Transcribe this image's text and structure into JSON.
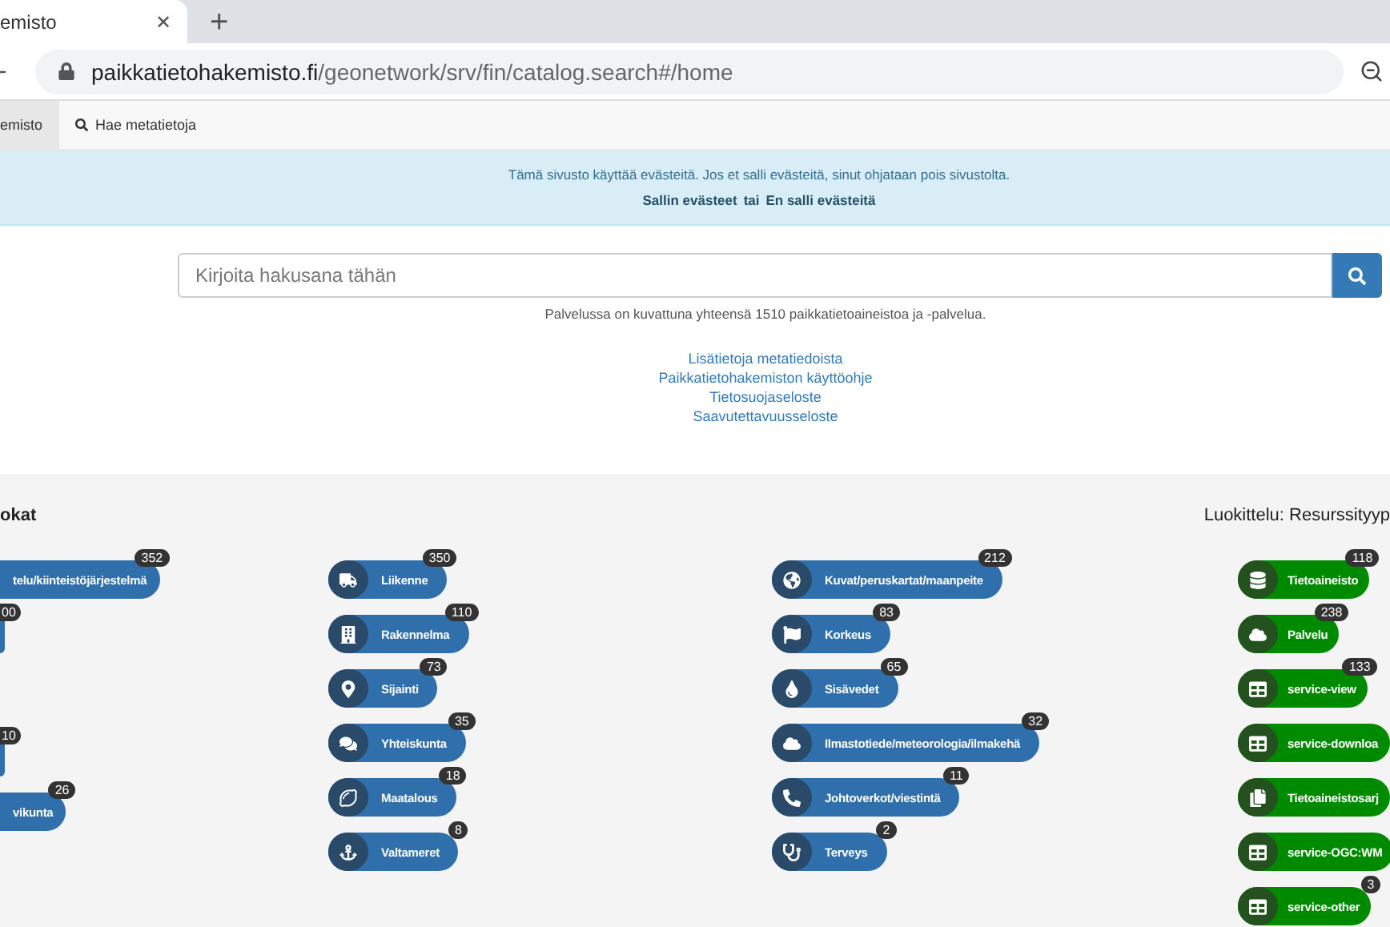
{
  "browser": {
    "tab_title": "emisto",
    "tab_close": "✕",
    "new_tab": "+",
    "url_domain": "paikkatietohakemisto.fi",
    "url_path": "/geonetwork/srv/fin/catalog.search#/home"
  },
  "nav": {
    "items": [
      {
        "label": "emisto",
        "selected": true
      },
      {
        "label": "Hae metatietoja",
        "selected": false
      }
    ]
  },
  "cookie_banner": {
    "text": "Tämä sivusto käyttää evästeitä. Jos et salli evästeitä, sinut ohjataan pois sivustolta.",
    "accept": "Sallin evästeet",
    "separator": "tai",
    "decline": "En salli evästeitä"
  },
  "search": {
    "placeholder": "Kirjoita hakusana tähän"
  },
  "summary": "Palvelussa on kuvattuna yhteensä 1510 paikkatietoaineistoa ja -palvelua.",
  "links": [
    "Lisätietoja metatiedoista",
    "Paikkatietohakemiston käyttöohje",
    "Tietosuojaseloste",
    "Saavutettavuusseloste"
  ],
  "categories": {
    "title": "okat",
    "classification_title": "Luokittelu: Resurssityyp",
    "column_1": [
      {
        "label": "telu/kiinteistöjärjestelmä",
        "count": "352"
      },
      {
        "count": "00"
      },
      {
        "count": "10"
      },
      {
        "label": "vikunta",
        "count": "26"
      }
    ],
    "column_2": [
      {
        "label": "Liikenne",
        "count": "350"
      },
      {
        "label": "Rakennelma",
        "count": "110"
      },
      {
        "label": "Sijainti",
        "count": "73"
      },
      {
        "label": "Yhteiskunta",
        "count": "35"
      },
      {
        "label": "Maatalous",
        "count": "18"
      },
      {
        "label": "Valtameret",
        "count": "8"
      }
    ],
    "column_3": [
      {
        "label": "Kuvat/peruskartat/maanpeite",
        "count": "212"
      },
      {
        "label": "Korkeus",
        "count": "83"
      },
      {
        "label": "Sisävedet",
        "count": "65"
      },
      {
        "label": "Ilmastotiede/meteorologia/ilmakehä",
        "count": "32"
      },
      {
        "label": "Johtoverkot/viestintä",
        "count": "11"
      },
      {
        "label": "Terveys",
        "count": "2"
      }
    ],
    "resource_types": [
      {
        "label": "Tietoaineisto",
        "count": "118"
      },
      {
        "label": "Palvelu",
        "count": "238"
      },
      {
        "label": "service-view",
        "count": "133"
      },
      {
        "label": "service-downloa"
      },
      {
        "label": "Tietoaineistosarj"
      },
      {
        "label": "service-OGC:WM"
      },
      {
        "label": "service-other",
        "count": "3"
      }
    ]
  }
}
